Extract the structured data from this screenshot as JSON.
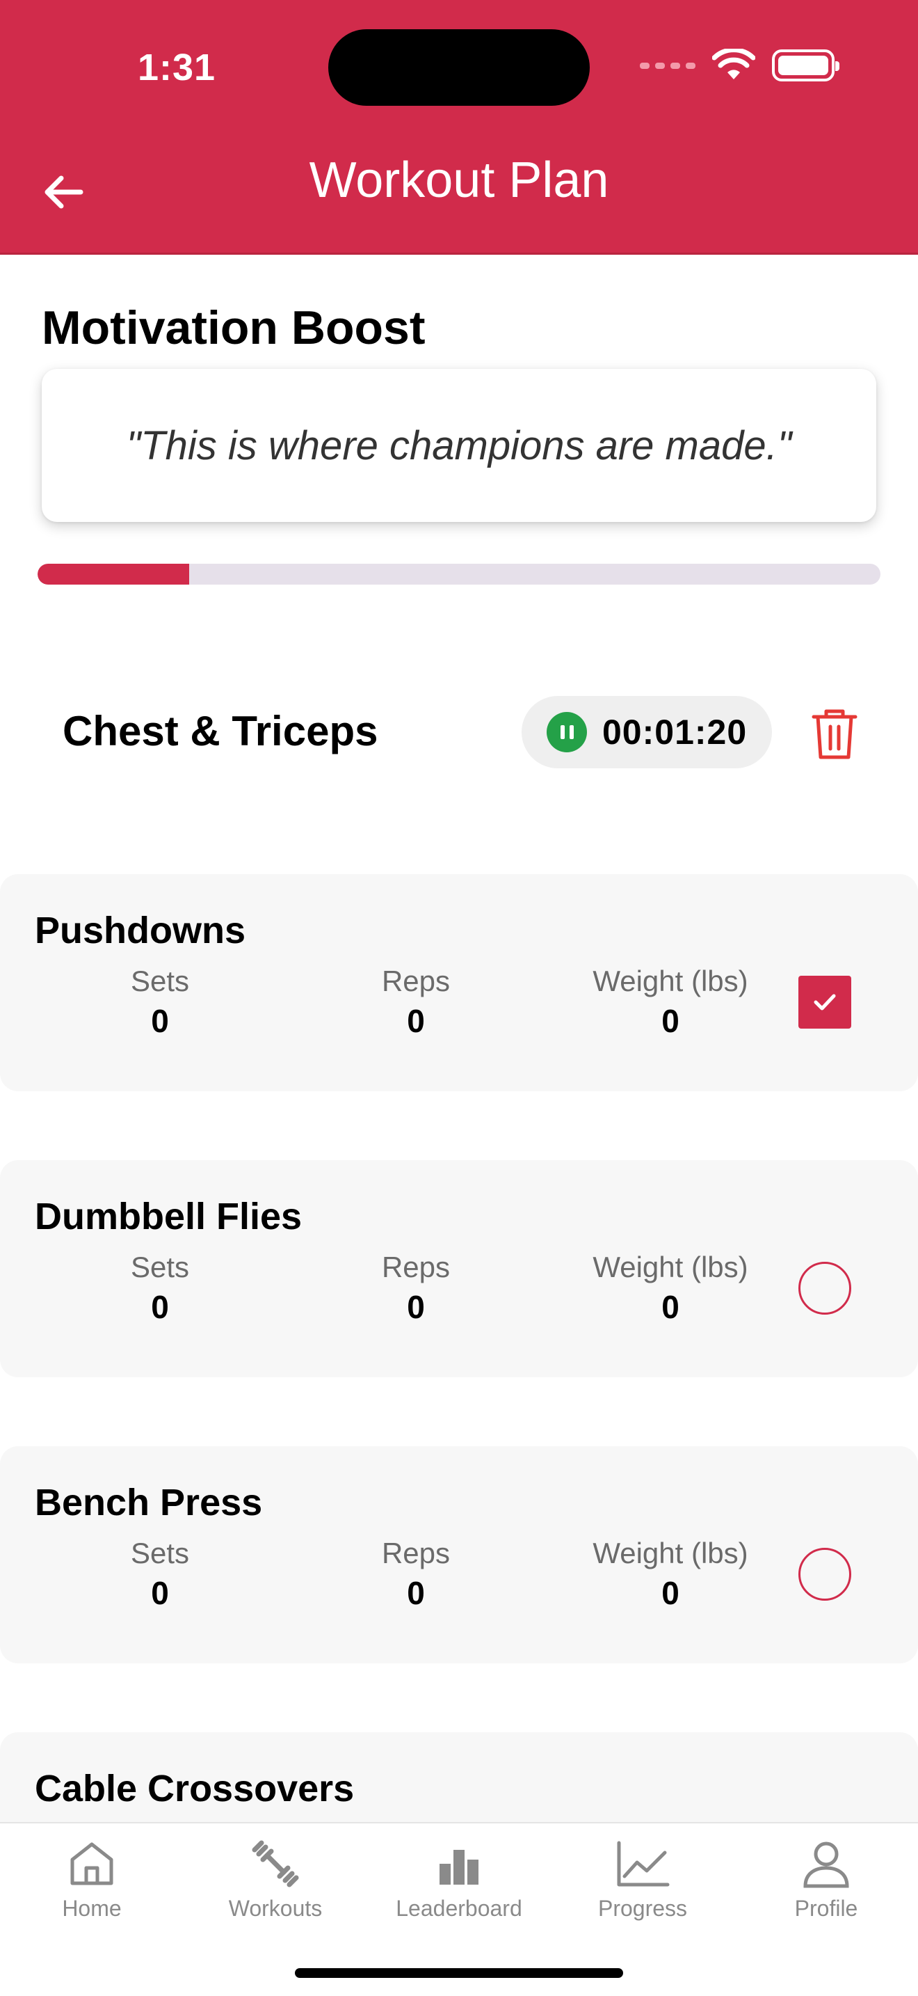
{
  "status_bar": {
    "time": "1:31"
  },
  "header": {
    "title": "Workout Plan"
  },
  "motivation": {
    "title": "Motivation Boost",
    "quote": "\"This is where champions are made.\""
  },
  "progress": {
    "fraction": 0.18,
    "fill_color": "#d12b4b"
  },
  "workout": {
    "name": "Chest & Triceps",
    "timer": "00:01:20"
  },
  "exercises": [
    {
      "name": "Pushdowns",
      "sets_label": "Sets",
      "sets": "0",
      "reps_label": "Reps",
      "reps": "0",
      "weight_label": "Weight (lbs)",
      "weight": "0",
      "completed": true
    },
    {
      "name": "Dumbbell Flies",
      "sets_label": "Sets",
      "sets": "0",
      "reps_label": "Reps",
      "reps": "0",
      "weight_label": "Weight (lbs)",
      "weight": "0",
      "completed": false
    },
    {
      "name": "Bench Press",
      "sets_label": "Sets",
      "sets": "0",
      "reps_label": "Reps",
      "reps": "0",
      "weight_label": "Weight (lbs)",
      "weight": "0",
      "completed": false
    },
    {
      "name": "Cable Crossovers"
    }
  ],
  "tabs": [
    {
      "label": "Home",
      "icon": "home-icon"
    },
    {
      "label": "Workouts",
      "icon": "dumbbell-icon"
    },
    {
      "label": "Leaderboard",
      "icon": "bar-chart-icon"
    },
    {
      "label": "Progress",
      "icon": "line-chart-icon"
    },
    {
      "label": "Profile",
      "icon": "profile-icon"
    }
  ],
  "colors": {
    "primary": "#d12b4b",
    "timer_active": "#24a148",
    "trash": "#e53935"
  }
}
